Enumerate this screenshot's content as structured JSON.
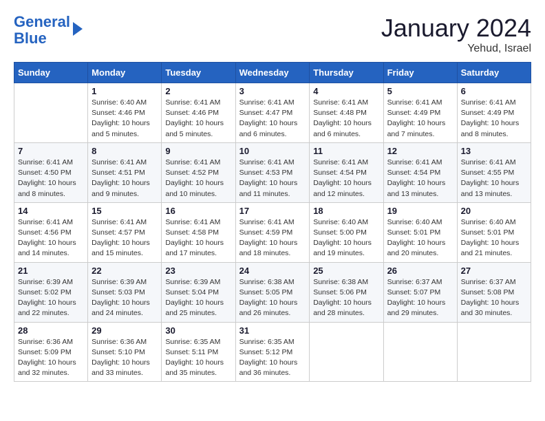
{
  "header": {
    "logo_line1": "General",
    "logo_line2": "Blue",
    "month_year": "January 2024",
    "location": "Yehud, Israel"
  },
  "days_of_week": [
    "Sunday",
    "Monday",
    "Tuesday",
    "Wednesday",
    "Thursday",
    "Friday",
    "Saturday"
  ],
  "weeks": [
    [
      {
        "day": "",
        "info": ""
      },
      {
        "day": "1",
        "info": "Sunrise: 6:40 AM\nSunset: 4:46 PM\nDaylight: 10 hours\nand 5 minutes."
      },
      {
        "day": "2",
        "info": "Sunrise: 6:41 AM\nSunset: 4:46 PM\nDaylight: 10 hours\nand 5 minutes."
      },
      {
        "day": "3",
        "info": "Sunrise: 6:41 AM\nSunset: 4:47 PM\nDaylight: 10 hours\nand 6 minutes."
      },
      {
        "day": "4",
        "info": "Sunrise: 6:41 AM\nSunset: 4:48 PM\nDaylight: 10 hours\nand 6 minutes."
      },
      {
        "day": "5",
        "info": "Sunrise: 6:41 AM\nSunset: 4:49 PM\nDaylight: 10 hours\nand 7 minutes."
      },
      {
        "day": "6",
        "info": "Sunrise: 6:41 AM\nSunset: 4:49 PM\nDaylight: 10 hours\nand 8 minutes."
      }
    ],
    [
      {
        "day": "7",
        "info": "Sunrise: 6:41 AM\nSunset: 4:50 PM\nDaylight: 10 hours\nand 8 minutes."
      },
      {
        "day": "8",
        "info": "Sunrise: 6:41 AM\nSunset: 4:51 PM\nDaylight: 10 hours\nand 9 minutes."
      },
      {
        "day": "9",
        "info": "Sunrise: 6:41 AM\nSunset: 4:52 PM\nDaylight: 10 hours\nand 10 minutes."
      },
      {
        "day": "10",
        "info": "Sunrise: 6:41 AM\nSunset: 4:53 PM\nDaylight: 10 hours\nand 11 minutes."
      },
      {
        "day": "11",
        "info": "Sunrise: 6:41 AM\nSunset: 4:54 PM\nDaylight: 10 hours\nand 12 minutes."
      },
      {
        "day": "12",
        "info": "Sunrise: 6:41 AM\nSunset: 4:54 PM\nDaylight: 10 hours\nand 13 minutes."
      },
      {
        "day": "13",
        "info": "Sunrise: 6:41 AM\nSunset: 4:55 PM\nDaylight: 10 hours\nand 13 minutes."
      }
    ],
    [
      {
        "day": "14",
        "info": "Sunrise: 6:41 AM\nSunset: 4:56 PM\nDaylight: 10 hours\nand 14 minutes."
      },
      {
        "day": "15",
        "info": "Sunrise: 6:41 AM\nSunset: 4:57 PM\nDaylight: 10 hours\nand 15 minutes."
      },
      {
        "day": "16",
        "info": "Sunrise: 6:41 AM\nSunset: 4:58 PM\nDaylight: 10 hours\nand 17 minutes."
      },
      {
        "day": "17",
        "info": "Sunrise: 6:41 AM\nSunset: 4:59 PM\nDaylight: 10 hours\nand 18 minutes."
      },
      {
        "day": "18",
        "info": "Sunrise: 6:40 AM\nSunset: 5:00 PM\nDaylight: 10 hours\nand 19 minutes."
      },
      {
        "day": "19",
        "info": "Sunrise: 6:40 AM\nSunset: 5:01 PM\nDaylight: 10 hours\nand 20 minutes."
      },
      {
        "day": "20",
        "info": "Sunrise: 6:40 AM\nSunset: 5:01 PM\nDaylight: 10 hours\nand 21 minutes."
      }
    ],
    [
      {
        "day": "21",
        "info": "Sunrise: 6:39 AM\nSunset: 5:02 PM\nDaylight: 10 hours\nand 22 minutes."
      },
      {
        "day": "22",
        "info": "Sunrise: 6:39 AM\nSunset: 5:03 PM\nDaylight: 10 hours\nand 24 minutes."
      },
      {
        "day": "23",
        "info": "Sunrise: 6:39 AM\nSunset: 5:04 PM\nDaylight: 10 hours\nand 25 minutes."
      },
      {
        "day": "24",
        "info": "Sunrise: 6:38 AM\nSunset: 5:05 PM\nDaylight: 10 hours\nand 26 minutes."
      },
      {
        "day": "25",
        "info": "Sunrise: 6:38 AM\nSunset: 5:06 PM\nDaylight: 10 hours\nand 28 minutes."
      },
      {
        "day": "26",
        "info": "Sunrise: 6:37 AM\nSunset: 5:07 PM\nDaylight: 10 hours\nand 29 minutes."
      },
      {
        "day": "27",
        "info": "Sunrise: 6:37 AM\nSunset: 5:08 PM\nDaylight: 10 hours\nand 30 minutes."
      }
    ],
    [
      {
        "day": "28",
        "info": "Sunrise: 6:36 AM\nSunset: 5:09 PM\nDaylight: 10 hours\nand 32 minutes."
      },
      {
        "day": "29",
        "info": "Sunrise: 6:36 AM\nSunset: 5:10 PM\nDaylight: 10 hours\nand 33 minutes."
      },
      {
        "day": "30",
        "info": "Sunrise: 6:35 AM\nSunset: 5:11 PM\nDaylight: 10 hours\nand 35 minutes."
      },
      {
        "day": "31",
        "info": "Sunrise: 6:35 AM\nSunset: 5:12 PM\nDaylight: 10 hours\nand 36 minutes."
      },
      {
        "day": "",
        "info": ""
      },
      {
        "day": "",
        "info": ""
      },
      {
        "day": "",
        "info": ""
      }
    ]
  ]
}
